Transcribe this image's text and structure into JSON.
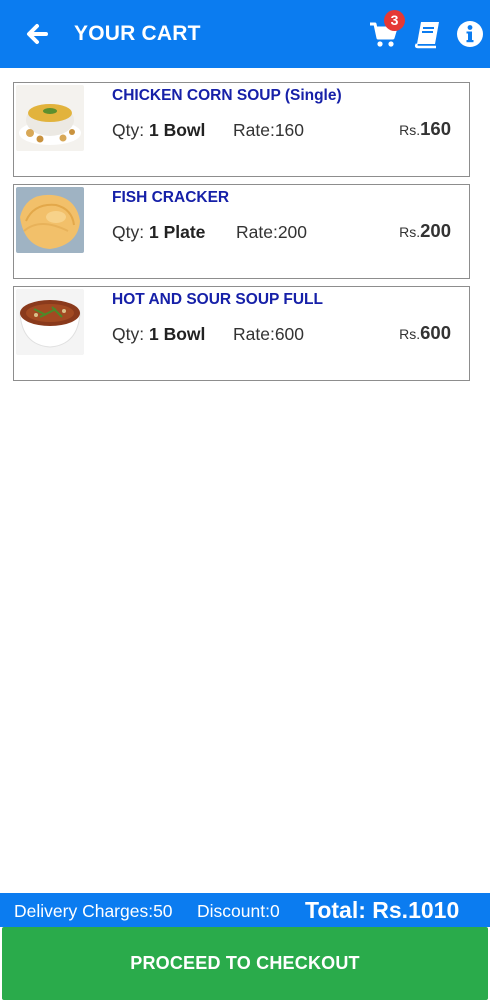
{
  "header": {
    "title": "YOUR CART",
    "cart_count": "3",
    "back_icon": "arrow-left-icon",
    "cart_icon": "cart-icon",
    "book_icon": "book-icon",
    "info_icon": "info-icon"
  },
  "items": [
    {
      "name": "CHICKEN CORN SOUP (Single)",
      "qty_label": "Qty:",
      "qty": "1 Bowl",
      "rate": "Rate:160",
      "currency": "Rs.",
      "amount": "160"
    },
    {
      "name": "FISH CRACKER",
      "qty_label": "Qty:",
      "qty": "1 Plate",
      "rate": "Rate:200",
      "currency": "Rs.",
      "amount": "200"
    },
    {
      "name": "HOT AND SOUR SOUP FULL",
      "qty_label": "Qty:",
      "qty": "1 Bowl",
      "rate": "Rate:600",
      "currency": "Rs.",
      "amount": "600"
    }
  ],
  "summary": {
    "delivery": "Delivery Charges:50",
    "discount": "Discount:0",
    "total": "Total: Rs.1010"
  },
  "checkout_label": "PROCEED TO CHECKOUT",
  "colors": {
    "primary": "#0b7cf0",
    "accent_green": "#2aab4b",
    "item_title": "#1620a8",
    "badge": "#e53935"
  }
}
